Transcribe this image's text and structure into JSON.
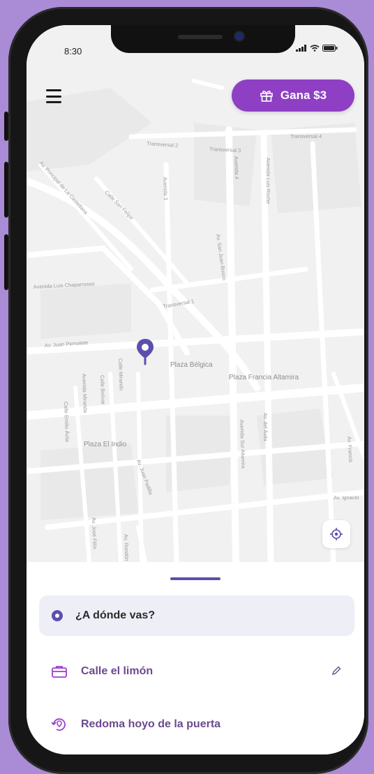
{
  "status_bar": {
    "time": "8:30"
  },
  "header": {
    "promo_label": "Gana $3"
  },
  "map": {
    "streets": [
      "Transversal 2",
      "Transversal 3",
      "Transversal 4",
      "Avenida 3",
      "Avenida 4",
      "Avenida Luis Roche",
      "Av. Principal de La Castellana",
      "Calle San Felipe",
      "Avenida Luis Chaparrosso",
      "Transversal 1",
      "Av. San Juan Bosco",
      "Av. Juan Pernalete",
      "Calle Mirando",
      "Calle Bolívar",
      "Avenida Miranda",
      "Calle Emilio Ávila",
      "Avenida Sur Altamira",
      "Av. del Ávila",
      "Av. José Félix",
      "Av. Juan Padilla",
      "Av. Rondón",
      "Av. Francia",
      "Av. Ignacio"
    ],
    "places": [
      "Plaza Bélgica",
      "Plaza Francia Altamira",
      "Plaza El Indio"
    ]
  },
  "sheet": {
    "search_placeholder": "¿A dónde vas?",
    "saved": [
      {
        "label": "Calle el limón",
        "icon": "briefcase-icon"
      },
      {
        "label": "Redoma hoyo de la puerta",
        "icon": "location-history-icon"
      }
    ]
  },
  "colors": {
    "accent": "#8e3fc4",
    "primary": "#5b4fae",
    "background": "#a98bd6"
  }
}
